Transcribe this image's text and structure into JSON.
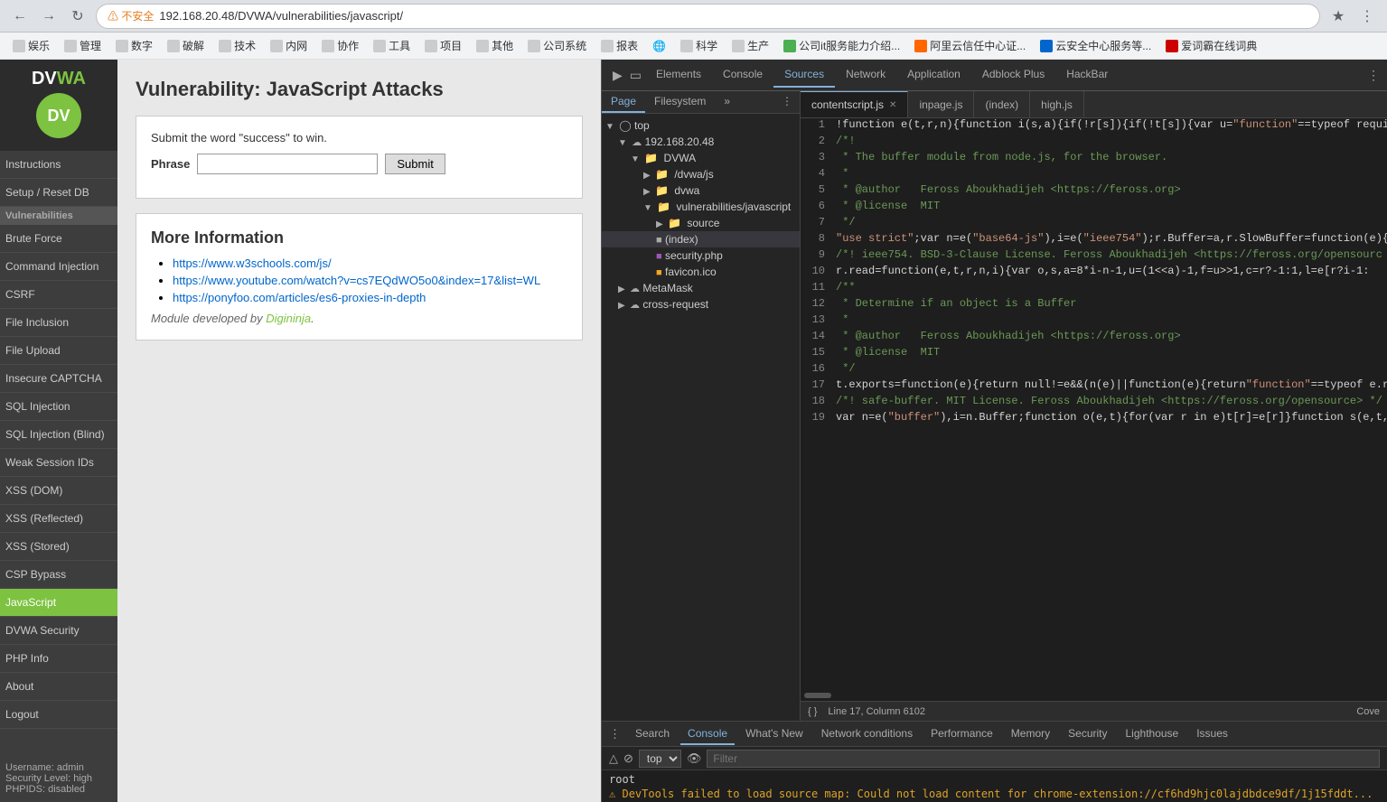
{
  "browser": {
    "url": "192.168.20.48/DVWA/vulnerabilities/javascript/",
    "warning": "⚠ 不安全",
    "bookmarks": [
      {
        "label": "娱乐"
      },
      {
        "label": "管理"
      },
      {
        "label": "数字"
      },
      {
        "label": "破解"
      },
      {
        "label": "技术"
      },
      {
        "label": "内网"
      },
      {
        "label": "协作"
      },
      {
        "label": "工具"
      },
      {
        "label": "项目"
      },
      {
        "label": "其他"
      },
      {
        "label": "公司系统"
      },
      {
        "label": "报表"
      },
      {
        "label": "🌐"
      },
      {
        "label": "科学"
      },
      {
        "label": "生产"
      },
      {
        "label": "公司it服务能力介绍..."
      },
      {
        "label": "阿里云信任中心证..."
      },
      {
        "label": "云安全中心服务等..."
      },
      {
        "label": "爱词霸在线词典"
      }
    ]
  },
  "sidebar": {
    "logo": "DVWA",
    "items": [
      {
        "label": "Instructions",
        "active": false
      },
      {
        "label": "Setup / Reset DB",
        "active": false
      },
      {
        "label": "Brute Force",
        "active": false
      },
      {
        "label": "Command Injection",
        "active": false
      },
      {
        "label": "CSRF",
        "active": false
      },
      {
        "label": "File Inclusion",
        "active": false
      },
      {
        "label": "File Upload",
        "active": false
      },
      {
        "label": "Insecure CAPTCHA",
        "active": false
      },
      {
        "label": "SQL Injection",
        "active": false
      },
      {
        "label": "SQL Injection (Blind)",
        "active": false
      },
      {
        "label": "Weak Session IDs",
        "active": false
      },
      {
        "label": "XSS (DOM)",
        "active": false
      },
      {
        "label": "XSS (Reflected)",
        "active": false
      },
      {
        "label": "XSS (Stored)",
        "active": false
      },
      {
        "label": "CSP Bypass",
        "active": false
      },
      {
        "label": "JavaScript",
        "active": true
      },
      {
        "label": "DVWA Security",
        "active": false
      },
      {
        "label": "PHP Info",
        "active": false
      },
      {
        "label": "About",
        "active": false
      },
      {
        "label": "Logout",
        "active": false
      }
    ],
    "footer": {
      "username": "admin",
      "security": "high",
      "phpids": "disabled"
    }
  },
  "page": {
    "title": "Vulnerability: JavaScript Attacks",
    "submit_instruction": "Submit the word \"success\" to win.",
    "phrase_label": "Phrase",
    "phrase_placeholder": "",
    "submit_btn": "Submit",
    "more_info_title": "More Information",
    "links": [
      {
        "text": "https://www.w3schools.com/js/",
        "url": "#"
      },
      {
        "text": "https://www.youtube.com/watch?v=cs7EQdWO5o0&index=17&list=WL",
        "url": "#"
      },
      {
        "text": "https://ponyfoo.com/articles/es6-proxies-in-depth",
        "url": "#"
      }
    ],
    "module_credit": "Module developed by ",
    "module_author": "Digininja",
    "module_author_url": "#"
  },
  "devtools": {
    "tabs": [
      "Elements",
      "Console",
      "Sources",
      "Network",
      "Application",
      "Adblock Plus",
      "HackBar"
    ],
    "active_tab": "Sources",
    "file_tabs": [
      {
        "label": "contentscript.js",
        "active": true,
        "closeable": true
      },
      {
        "label": "inpage.js",
        "active": false,
        "closeable": false
      },
      {
        "label": "(index)",
        "active": false,
        "closeable": false
      },
      {
        "label": "high.js",
        "active": false,
        "closeable": false
      }
    ],
    "file_tree": {
      "items": [
        {
          "level": 0,
          "type": "folder",
          "label": "top",
          "expanded": true
        },
        {
          "level": 1,
          "type": "cloud",
          "label": "192.168.20.48",
          "expanded": true
        },
        {
          "level": 2,
          "type": "folder",
          "label": "DVWA",
          "expanded": true
        },
        {
          "level": 3,
          "type": "folder",
          "label": "/dvwa/js",
          "expanded": false
        },
        {
          "level": 3,
          "type": "folder",
          "label": "dvwa",
          "expanded": false
        },
        {
          "level": 3,
          "type": "folder",
          "label": "vulnerabilities/javascript",
          "expanded": true
        },
        {
          "level": 4,
          "type": "folder",
          "label": "source",
          "expanded": false
        },
        {
          "level": 4,
          "type": "file-html",
          "label": "(index)",
          "selected": true
        },
        {
          "level": 4,
          "type": "file-php",
          "label": "security.php"
        },
        {
          "level": 4,
          "type": "file-ico",
          "label": "favicon.ico"
        },
        {
          "level": 1,
          "type": "cloud",
          "label": "MetaMask",
          "expanded": false
        },
        {
          "level": 1,
          "type": "cloud",
          "label": "cross-request",
          "expanded": false
        }
      ]
    },
    "code_lines": [
      {
        "n": 1,
        "content": "!function e(t,r,n){function i(s,a){if(!r[s]){if(!t[s]){var u=\"function\"==typeof requi"
      },
      {
        "n": 2,
        "content": "/*!"
      },
      {
        "n": 3,
        "content": " * The buffer module from node.js, for the browser."
      },
      {
        "n": 4,
        "content": " *"
      },
      {
        "n": 5,
        "content": " * @author   Feross Aboukhadijeh <https://feross.org>"
      },
      {
        "n": 6,
        "content": " * @license  MIT"
      },
      {
        "n": 7,
        "content": " */"
      },
      {
        "n": 8,
        "content": "\"use strict\";var n=e(\"base64-js\"),i=e(\"ieee754\");r.Buffer=a,r.SlowBuffer=function(e){"
      },
      {
        "n": 9,
        "content": "/*! ieee754. BSD-3-Clause License. Feross Aboukhadijeh <https://feross.org/opensourc"
      },
      {
        "n": 10,
        "content": "r.read=function(e,t,r,n,i){var o,s,a=8*i-n-1,u=(1<<a)-1,f=u>>1,c=r?-1:1,l=e[r?i-1:"
      },
      {
        "n": 11,
        "content": "/**"
      },
      {
        "n": 12,
        "content": " * Determine if an object is a Buffer"
      },
      {
        "n": 13,
        "content": " *"
      },
      {
        "n": 14,
        "content": " * @author   Feross Aboukhadijeh <https://feross.org>"
      },
      {
        "n": 15,
        "content": " * @license  MIT"
      },
      {
        "n": 16,
        "content": " */"
      },
      {
        "n": 17,
        "content": "t.exports=function(e){return null!=e&&(n(e)||function(e){return\"function\"==typeof e.rea"
      },
      {
        "n": 18,
        "content": "/*! safe-buffer. MIT License. Feross Aboukhadijeh <https://feross.org/opensource> */"
      },
      {
        "n": 19,
        "content": "var n=e(\"buffer\"),i=n.Buffer;function o(e,t){for(var r in e)t[r]=e[r]}function s(e,t,r"
      }
    ],
    "status_bar": {
      "braces": "{ }",
      "position": "Line 17, Column 6102",
      "coverage": "Cove"
    },
    "console": {
      "tabs": [
        "Search",
        "Console",
        "What's New",
        "Network conditions",
        "Performance",
        "Memory",
        "Security",
        "Lighthouse",
        "Issues"
      ],
      "active_tab": "Console",
      "top_selector": "top",
      "filter_placeholder": "Filter",
      "lines": [
        {
          "text": "root",
          "type": "normal"
        },
        {
          "text": "⚠ DevTools failed to load source map: Could not load content for chrome-extension://cf6hd9hjc0lajdbdce9df/1j15fddt...",
          "type": "warning"
        }
      ]
    }
  }
}
